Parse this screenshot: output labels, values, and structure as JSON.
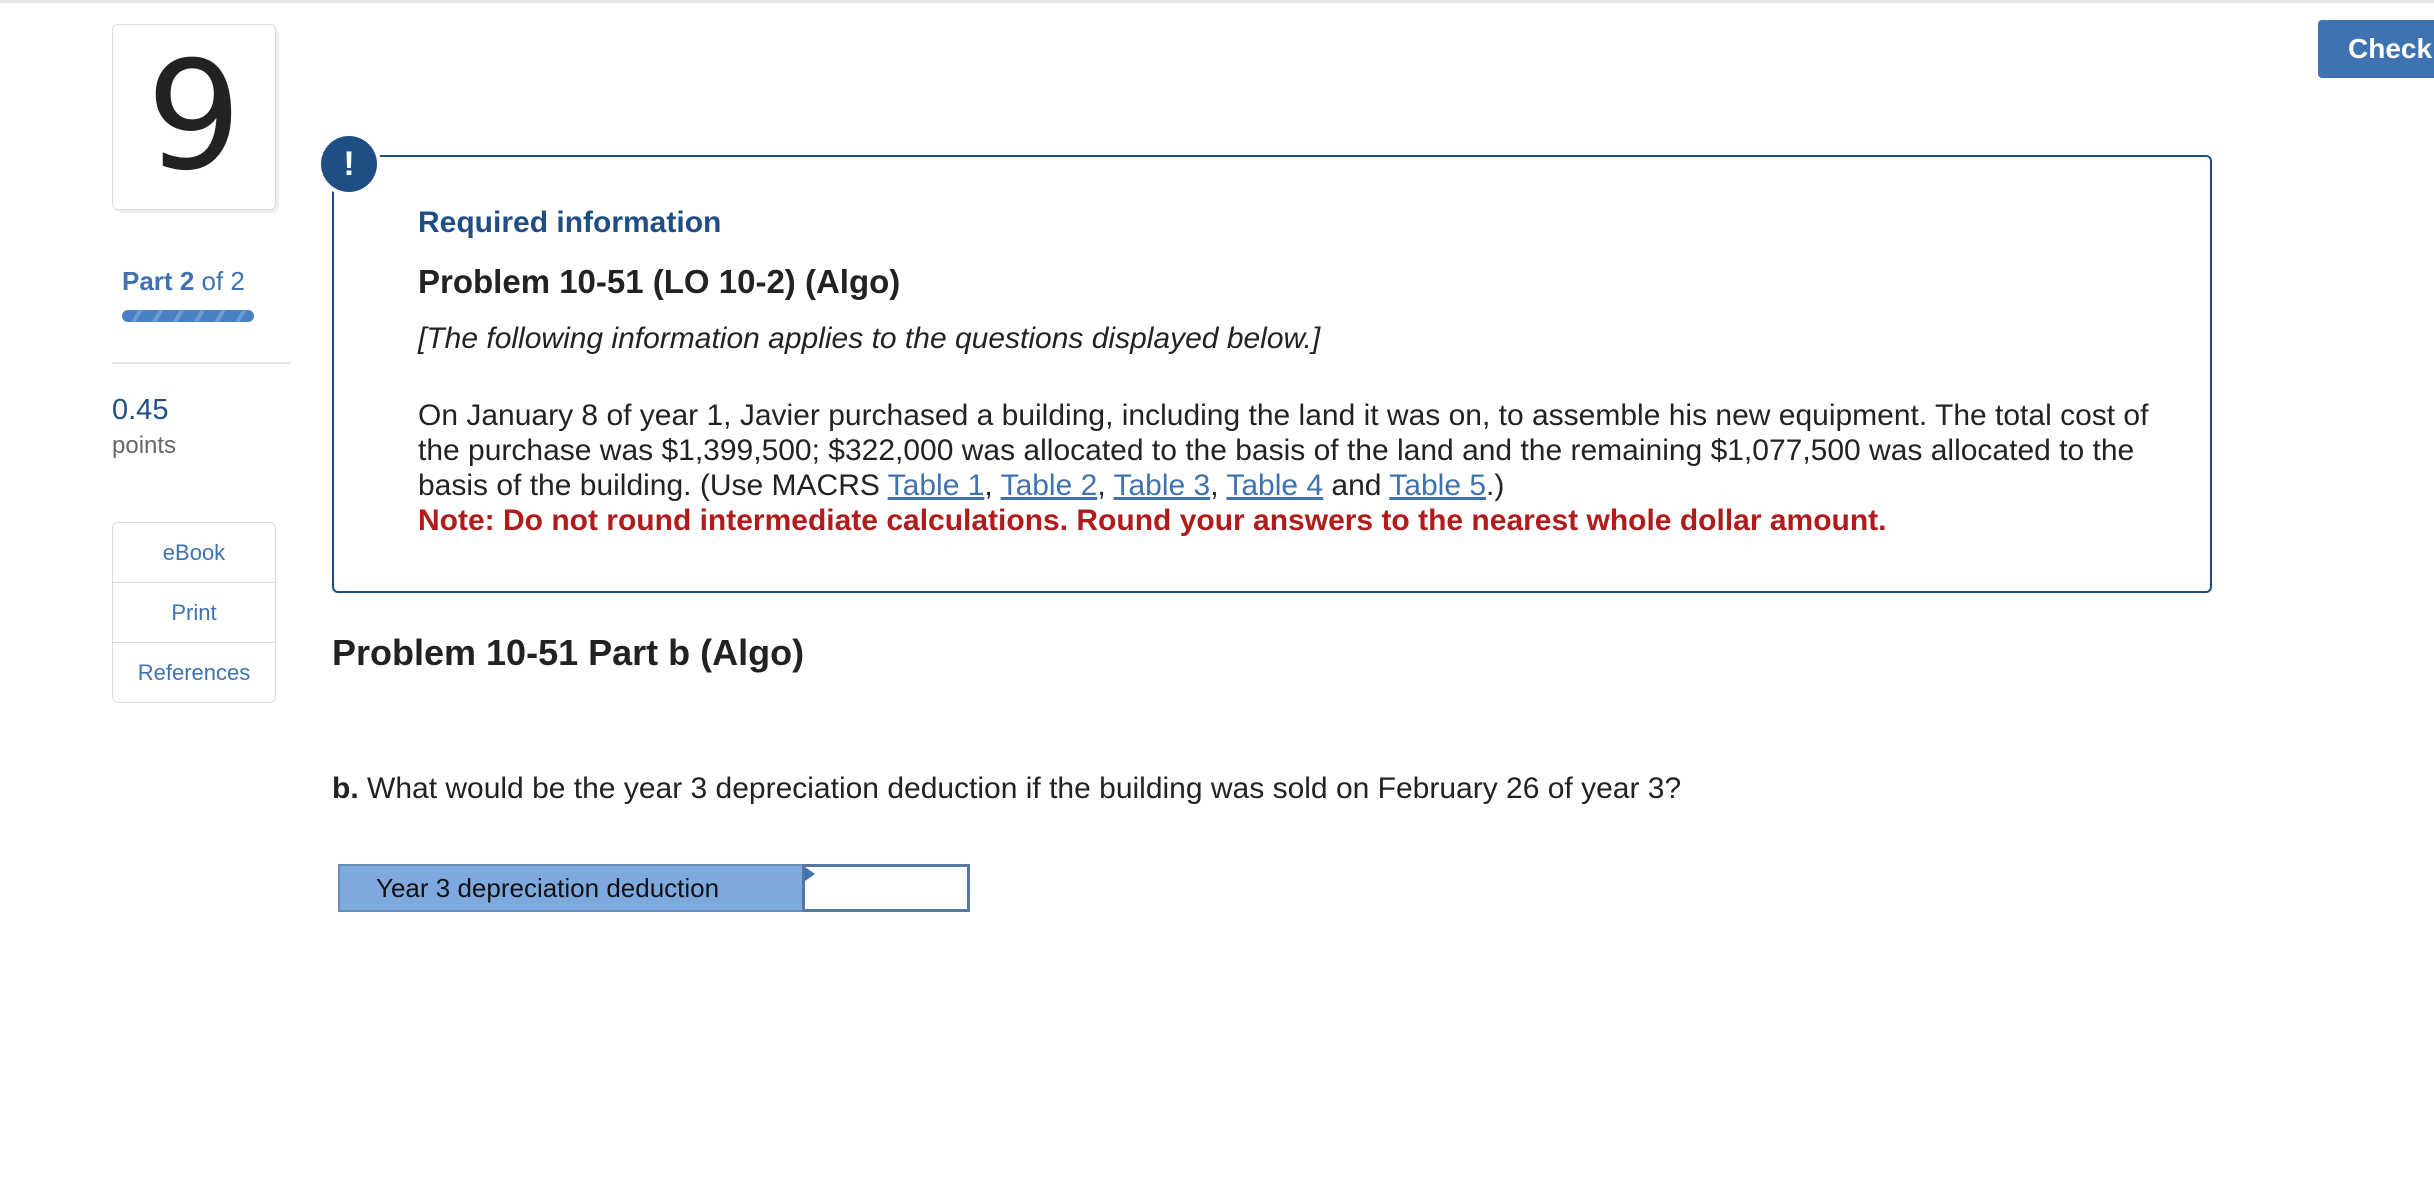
{
  "question_number": "9",
  "part": {
    "prefix": "Part",
    "current": "2",
    "of_label": "of 2",
    "progress": 1.0
  },
  "points": {
    "value": "0.45",
    "label": "points"
  },
  "resources": {
    "ebook": "eBook",
    "print": "Print",
    "references": "References"
  },
  "check_button": "Check",
  "info": {
    "badge": "!",
    "heading": "Required information",
    "problem_title": "Problem 10-51 (LO 10-2) (Algo)",
    "applies_note": "[The following information applies to the questions displayed below.]",
    "body": "On January 8 of year 1, Javier purchased a building, including the land it was on, to assemble his new equipment. The total cost of the purchase was $1,399,500; $322,000 was allocated to the basis of the land and the remaining $1,077,500 was allocated to the basis of the building. (Use MACRS ",
    "links": [
      "Table 1",
      "Table 2",
      "Table 3",
      "Table 4",
      "Table 5"
    ],
    "sep_comma": ", ",
    "sep_and": " and ",
    "body_end": ".)",
    "note": "Note: Do not round intermediate calculations. Round your answers to the nearest whole dollar amount."
  },
  "part_b": {
    "title": "Problem 10-51 Part b (Algo)",
    "question_prefix": "b.",
    "question": " What would be the year 3 depreciation deduction if the building was sold on February 26 of year 3?",
    "answer_label": "Year 3 depreciation deduction",
    "answer_value": ""
  },
  "colors": {
    "brand_blue": "#1f4e85",
    "link_blue": "#3f72b0",
    "note_red": "#b01c1c",
    "label_fill": "#7ea9df"
  }
}
